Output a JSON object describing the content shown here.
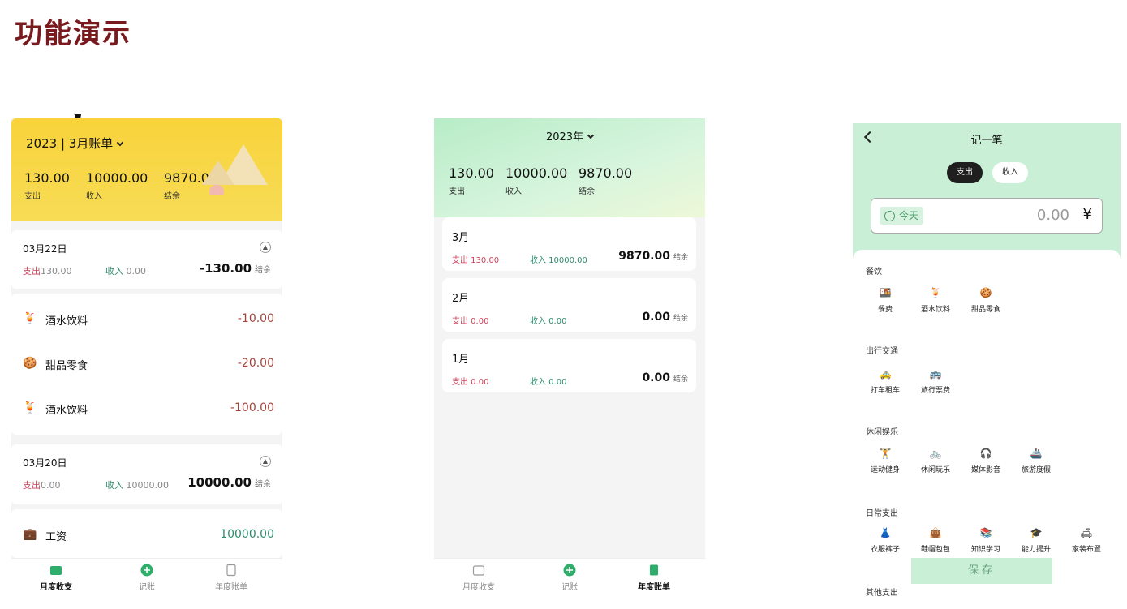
{
  "page_title": "功能演示",
  "screen1": {
    "selector": "2023 | 3月账单",
    "summary": [
      {
        "value": "130.00",
        "label": "支出"
      },
      {
        "value": "10000.00",
        "label": "收入"
      },
      {
        "value": "9870.00",
        "label": "结余"
      }
    ],
    "days": [
      {
        "date": "03月22日",
        "out_label": "支出",
        "out_value": "130.00",
        "in_label": "收入",
        "in_value": "0.00",
        "net": "-130.00",
        "net_label": "结余",
        "items": [
          {
            "name": "酒水饮料",
            "amount": "-10.00",
            "icon": "🍹"
          },
          {
            "name": "甜品零食",
            "amount": "-20.00",
            "icon": "🍪"
          },
          {
            "name": "酒水饮料",
            "amount": "-100.00",
            "icon": "🍹"
          }
        ]
      },
      {
        "date": "03月20日",
        "out_label": "支出",
        "out_value": "0.00",
        "in_label": "收入",
        "in_value": "10000.00",
        "net": "10000.00",
        "net_label": "结余",
        "items": [
          {
            "name": "工资",
            "amount": "10000.00",
            "icon": "💼"
          }
        ]
      }
    ],
    "tabs": [
      "月度收支",
      "记账",
      "年度账单"
    ]
  },
  "screen2": {
    "selector": "2023年",
    "summary": [
      {
        "value": "130.00",
        "label": "支出"
      },
      {
        "value": "10000.00",
        "label": "收入"
      },
      {
        "value": "9870.00",
        "label": "结余"
      }
    ],
    "months": [
      {
        "title": "3月",
        "out": "支出 130.00",
        "in": "收入 10000.00",
        "net": "9870.00",
        "net_label": "结余"
      },
      {
        "title": "2月",
        "out": "支出 0.00",
        "in": "收入 0.00",
        "net": "0.00",
        "net_label": "结余"
      },
      {
        "title": "1月",
        "out": "支出 0.00",
        "in": "收入 0.00",
        "net": "0.00",
        "net_label": "结余"
      }
    ],
    "tabs": [
      "月度收支",
      "记账",
      "年度账单"
    ]
  },
  "screen3": {
    "title": "记一笔",
    "seg_out": "支出",
    "seg_in": "收入",
    "today": "今天",
    "amount": "0.00",
    "currency": "¥",
    "groups": [
      {
        "title": "餐饮",
        "items": [
          {
            "name": "餐费",
            "icon": "🍱"
          },
          {
            "name": "酒水饮料",
            "icon": "🍹"
          },
          {
            "name": "甜品零食",
            "icon": "🍪"
          }
        ]
      },
      {
        "title": "出行交通",
        "items": [
          {
            "name": "打车租车",
            "icon": "🚕"
          },
          {
            "name": "旅行票费",
            "icon": "🚌"
          }
        ]
      },
      {
        "title": "休闲娱乐",
        "items": [
          {
            "name": "运动健身",
            "icon": "🏋"
          },
          {
            "name": "休闲玩乐",
            "icon": "🚲"
          },
          {
            "name": "媒体影音",
            "icon": "🎧"
          },
          {
            "name": "旅游度假",
            "icon": "🚢"
          }
        ]
      },
      {
        "title": "日常支出",
        "items": [
          {
            "name": "衣服裤子",
            "icon": "👗"
          },
          {
            "name": "鞋帽包包",
            "icon": "👜"
          },
          {
            "name": "知识学习",
            "icon": "📚"
          },
          {
            "name": "能力提升",
            "icon": "🎓"
          },
          {
            "name": "家装布置",
            "icon": "🛋"
          }
        ]
      }
    ],
    "more_group": "其他支出",
    "save": "保存"
  }
}
